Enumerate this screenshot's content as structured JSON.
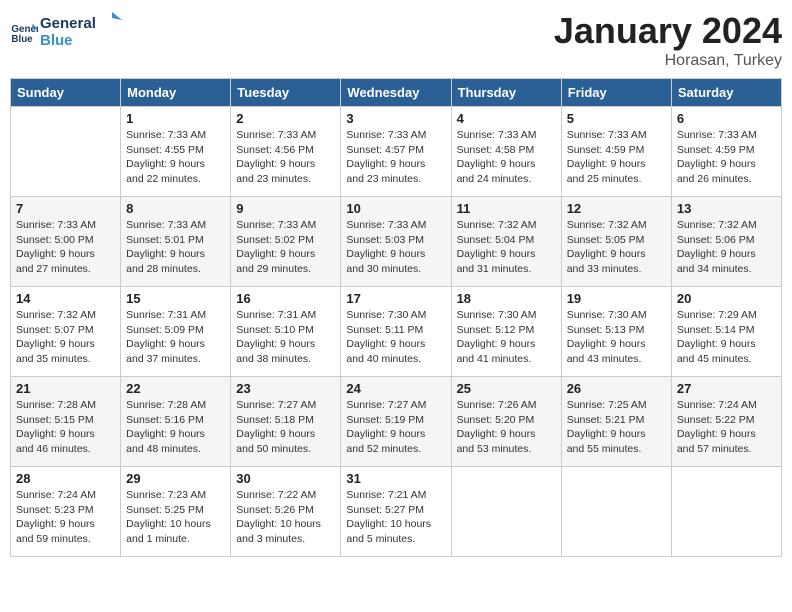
{
  "header": {
    "logo_line1": "General",
    "logo_line2": "Blue",
    "month_title": "January 2024",
    "location": "Horasan, Turkey"
  },
  "days_of_week": [
    "Sunday",
    "Monday",
    "Tuesday",
    "Wednesday",
    "Thursday",
    "Friday",
    "Saturday"
  ],
  "weeks": [
    [
      {
        "day": "",
        "info": ""
      },
      {
        "day": "1",
        "info": "Sunrise: 7:33 AM\nSunset: 4:55 PM\nDaylight: 9 hours\nand 22 minutes."
      },
      {
        "day": "2",
        "info": "Sunrise: 7:33 AM\nSunset: 4:56 PM\nDaylight: 9 hours\nand 23 minutes."
      },
      {
        "day": "3",
        "info": "Sunrise: 7:33 AM\nSunset: 4:57 PM\nDaylight: 9 hours\nand 23 minutes."
      },
      {
        "day": "4",
        "info": "Sunrise: 7:33 AM\nSunset: 4:58 PM\nDaylight: 9 hours\nand 24 minutes."
      },
      {
        "day": "5",
        "info": "Sunrise: 7:33 AM\nSunset: 4:59 PM\nDaylight: 9 hours\nand 25 minutes."
      },
      {
        "day": "6",
        "info": "Sunrise: 7:33 AM\nSunset: 4:59 PM\nDaylight: 9 hours\nand 26 minutes."
      }
    ],
    [
      {
        "day": "7",
        "info": "Sunrise: 7:33 AM\nSunset: 5:00 PM\nDaylight: 9 hours\nand 27 minutes."
      },
      {
        "day": "8",
        "info": "Sunrise: 7:33 AM\nSunset: 5:01 PM\nDaylight: 9 hours\nand 28 minutes."
      },
      {
        "day": "9",
        "info": "Sunrise: 7:33 AM\nSunset: 5:02 PM\nDaylight: 9 hours\nand 29 minutes."
      },
      {
        "day": "10",
        "info": "Sunrise: 7:33 AM\nSunset: 5:03 PM\nDaylight: 9 hours\nand 30 minutes."
      },
      {
        "day": "11",
        "info": "Sunrise: 7:32 AM\nSunset: 5:04 PM\nDaylight: 9 hours\nand 31 minutes."
      },
      {
        "day": "12",
        "info": "Sunrise: 7:32 AM\nSunset: 5:05 PM\nDaylight: 9 hours\nand 33 minutes."
      },
      {
        "day": "13",
        "info": "Sunrise: 7:32 AM\nSunset: 5:06 PM\nDaylight: 9 hours\nand 34 minutes."
      }
    ],
    [
      {
        "day": "14",
        "info": "Sunrise: 7:32 AM\nSunset: 5:07 PM\nDaylight: 9 hours\nand 35 minutes."
      },
      {
        "day": "15",
        "info": "Sunrise: 7:31 AM\nSunset: 5:09 PM\nDaylight: 9 hours\nand 37 minutes."
      },
      {
        "day": "16",
        "info": "Sunrise: 7:31 AM\nSunset: 5:10 PM\nDaylight: 9 hours\nand 38 minutes."
      },
      {
        "day": "17",
        "info": "Sunrise: 7:30 AM\nSunset: 5:11 PM\nDaylight: 9 hours\nand 40 minutes."
      },
      {
        "day": "18",
        "info": "Sunrise: 7:30 AM\nSunset: 5:12 PM\nDaylight: 9 hours\nand 41 minutes."
      },
      {
        "day": "19",
        "info": "Sunrise: 7:30 AM\nSunset: 5:13 PM\nDaylight: 9 hours\nand 43 minutes."
      },
      {
        "day": "20",
        "info": "Sunrise: 7:29 AM\nSunset: 5:14 PM\nDaylight: 9 hours\nand 45 minutes."
      }
    ],
    [
      {
        "day": "21",
        "info": "Sunrise: 7:28 AM\nSunset: 5:15 PM\nDaylight: 9 hours\nand 46 minutes."
      },
      {
        "day": "22",
        "info": "Sunrise: 7:28 AM\nSunset: 5:16 PM\nDaylight: 9 hours\nand 48 minutes."
      },
      {
        "day": "23",
        "info": "Sunrise: 7:27 AM\nSunset: 5:18 PM\nDaylight: 9 hours\nand 50 minutes."
      },
      {
        "day": "24",
        "info": "Sunrise: 7:27 AM\nSunset: 5:19 PM\nDaylight: 9 hours\nand 52 minutes."
      },
      {
        "day": "25",
        "info": "Sunrise: 7:26 AM\nSunset: 5:20 PM\nDaylight: 9 hours\nand 53 minutes."
      },
      {
        "day": "26",
        "info": "Sunrise: 7:25 AM\nSunset: 5:21 PM\nDaylight: 9 hours\nand 55 minutes."
      },
      {
        "day": "27",
        "info": "Sunrise: 7:24 AM\nSunset: 5:22 PM\nDaylight: 9 hours\nand 57 minutes."
      }
    ],
    [
      {
        "day": "28",
        "info": "Sunrise: 7:24 AM\nSunset: 5:23 PM\nDaylight: 9 hours\nand 59 minutes."
      },
      {
        "day": "29",
        "info": "Sunrise: 7:23 AM\nSunset: 5:25 PM\nDaylight: 10 hours\nand 1 minute."
      },
      {
        "day": "30",
        "info": "Sunrise: 7:22 AM\nSunset: 5:26 PM\nDaylight: 10 hours\nand 3 minutes."
      },
      {
        "day": "31",
        "info": "Sunrise: 7:21 AM\nSunset: 5:27 PM\nDaylight: 10 hours\nand 5 minutes."
      },
      {
        "day": "",
        "info": ""
      },
      {
        "day": "",
        "info": ""
      },
      {
        "day": "",
        "info": ""
      }
    ]
  ]
}
